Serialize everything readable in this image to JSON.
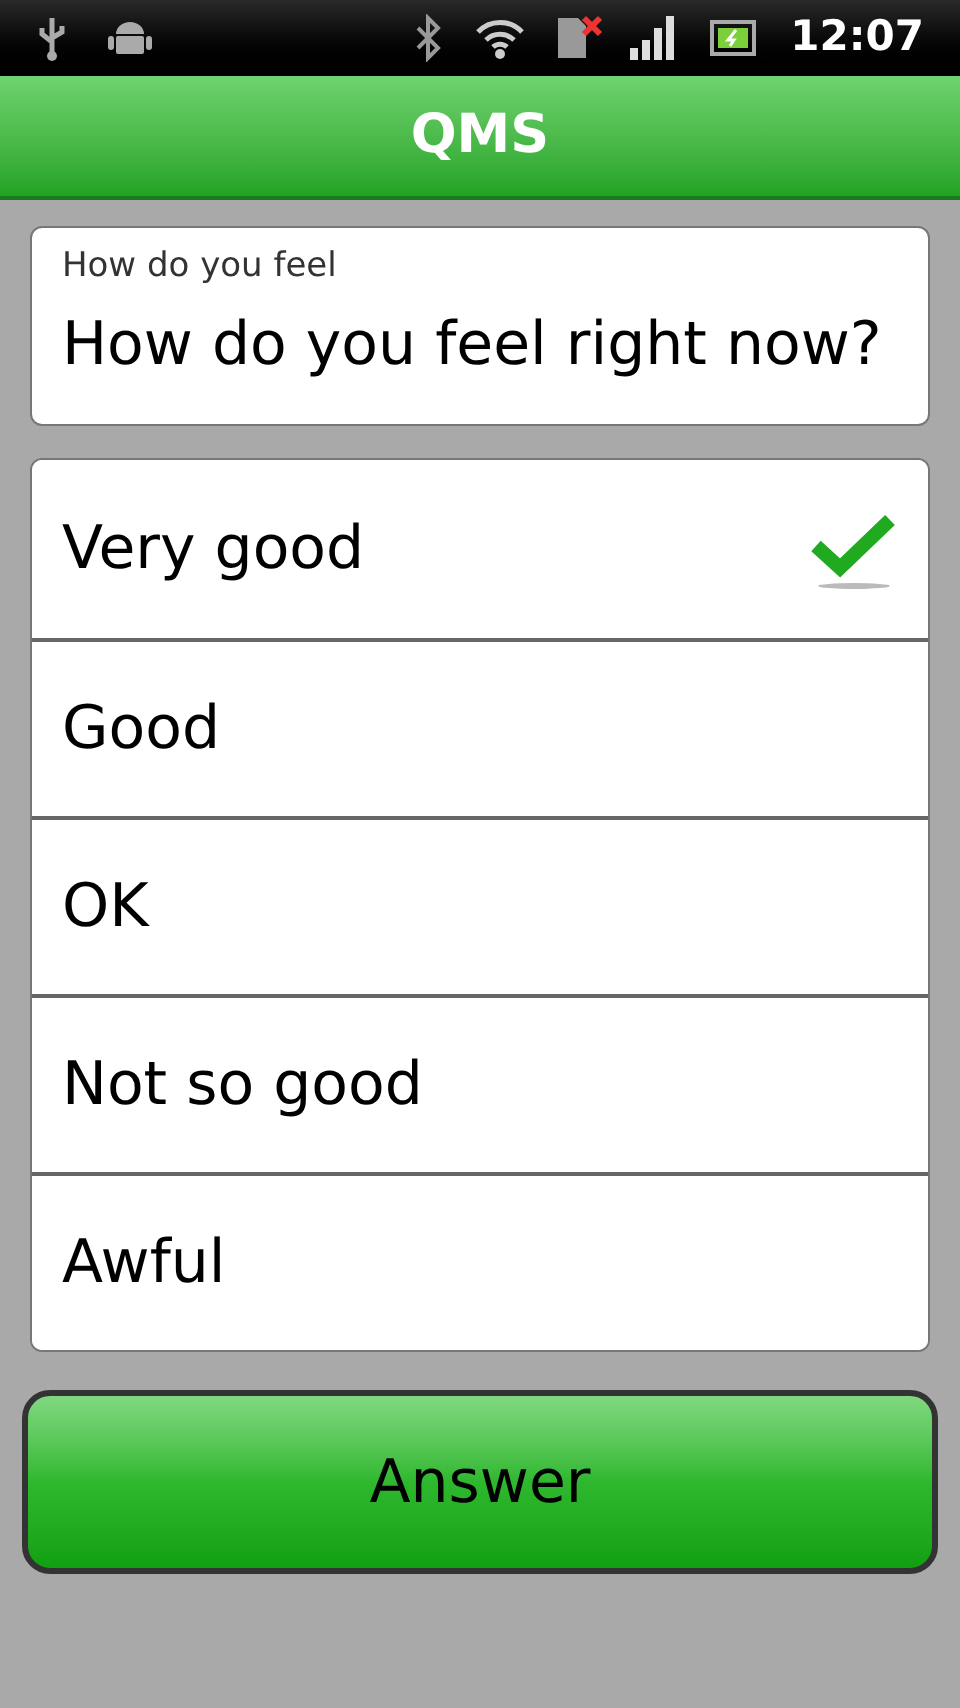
{
  "status_bar": {
    "time": "12:07"
  },
  "header": {
    "title": "QMS"
  },
  "question": {
    "label": "How do you feel",
    "text": "How do you feel right now?"
  },
  "options": [
    {
      "label": "Very good",
      "selected": true
    },
    {
      "label": "Good",
      "selected": false
    },
    {
      "label": "OK",
      "selected": false
    },
    {
      "label": "Not so good",
      "selected": false
    },
    {
      "label": "Awful",
      "selected": false
    }
  ],
  "button": {
    "label": "Answer"
  }
}
